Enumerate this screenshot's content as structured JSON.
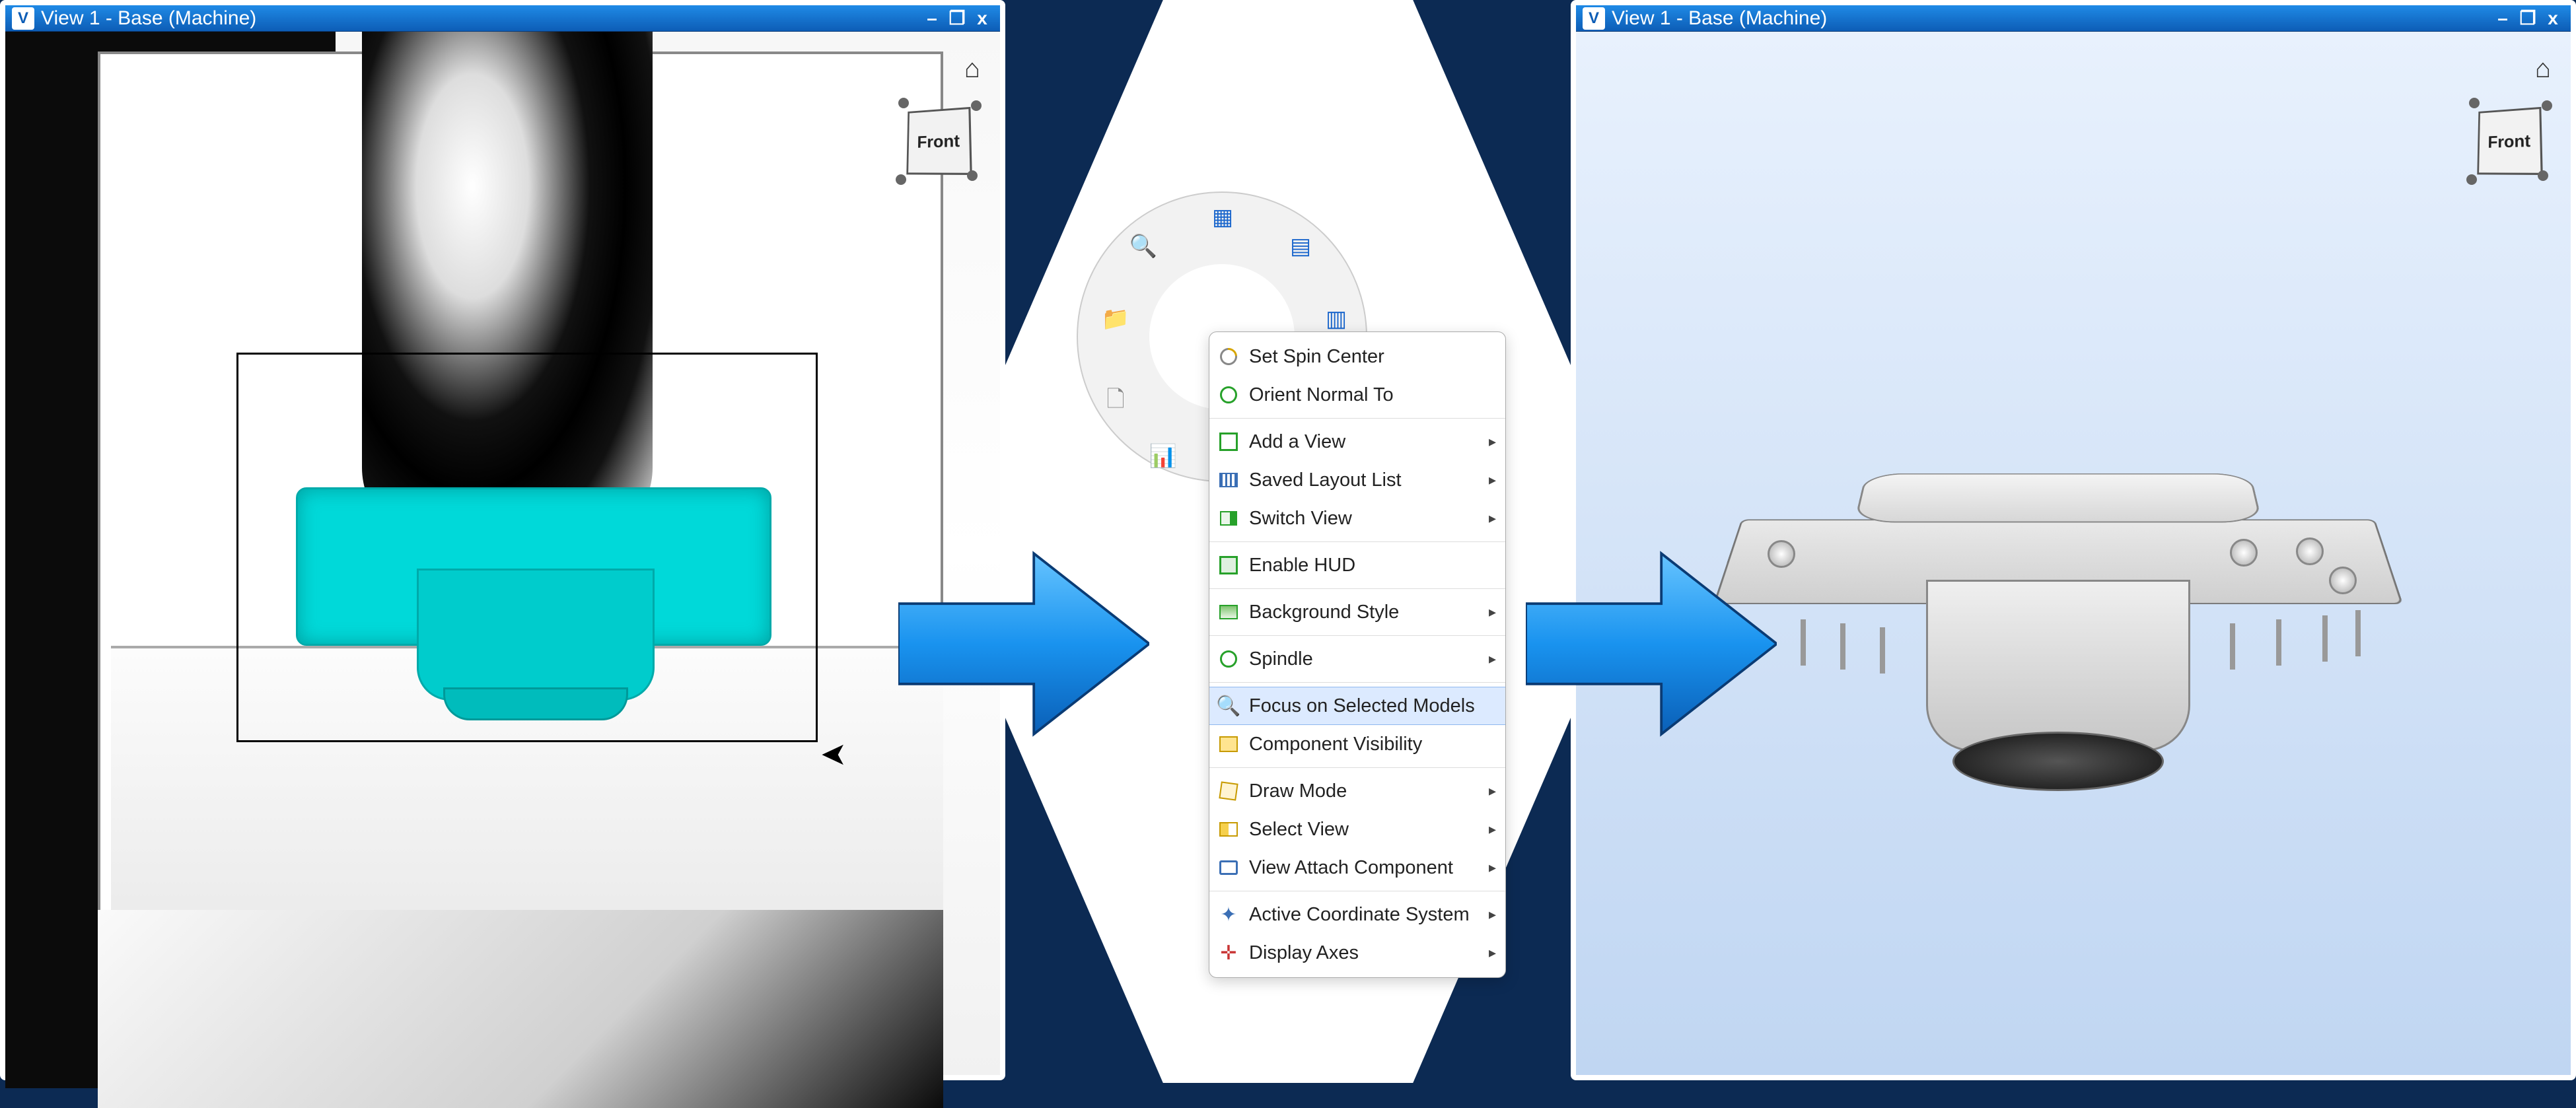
{
  "window": {
    "title": "View 1 - Base (Machine)",
    "app_letter": "V",
    "minimize": "–",
    "maximize": "❐",
    "close": "x"
  },
  "viewcube": {
    "face": "Front"
  },
  "home": "⌂",
  "menu": {
    "items": [
      {
        "id": "set-spin-center",
        "label": "Set Spin Center",
        "submenu": false
      },
      {
        "id": "orient-normal-to",
        "label": "Orient Normal To",
        "submenu": false
      },
      {
        "id": "add-a-view",
        "label": "Add a View",
        "submenu": true
      },
      {
        "id": "saved-layout-list",
        "label": "Saved Layout List",
        "submenu": true
      },
      {
        "id": "switch-view",
        "label": "Switch View",
        "submenu": true
      },
      {
        "id": "enable-hud",
        "label": "Enable HUD",
        "submenu": false
      },
      {
        "id": "background-style",
        "label": "Background Style",
        "submenu": true
      },
      {
        "id": "spindle",
        "label": "Spindle",
        "submenu": true
      },
      {
        "id": "focus-selected",
        "label": "Focus on Selected Models",
        "submenu": false,
        "highlight": true
      },
      {
        "id": "component-vis",
        "label": "Component Visibility",
        "submenu": false
      },
      {
        "id": "draw-mode",
        "label": "Draw Mode",
        "submenu": true
      },
      {
        "id": "select-view",
        "label": "Select View",
        "submenu": true
      },
      {
        "id": "view-attach-comp",
        "label": "View Attach Component",
        "submenu": true
      },
      {
        "id": "active-coord-sys",
        "label": "Active Coordinate System",
        "submenu": true
      },
      {
        "id": "display-axes",
        "label": "Display Axes",
        "submenu": true
      }
    ],
    "submenu_arrow": "▸"
  },
  "radial": {
    "icons": [
      "tool-1",
      "tool-2",
      "tool-3",
      "tool-4",
      "tool-5",
      "tool-6",
      "tool-7"
    ]
  }
}
